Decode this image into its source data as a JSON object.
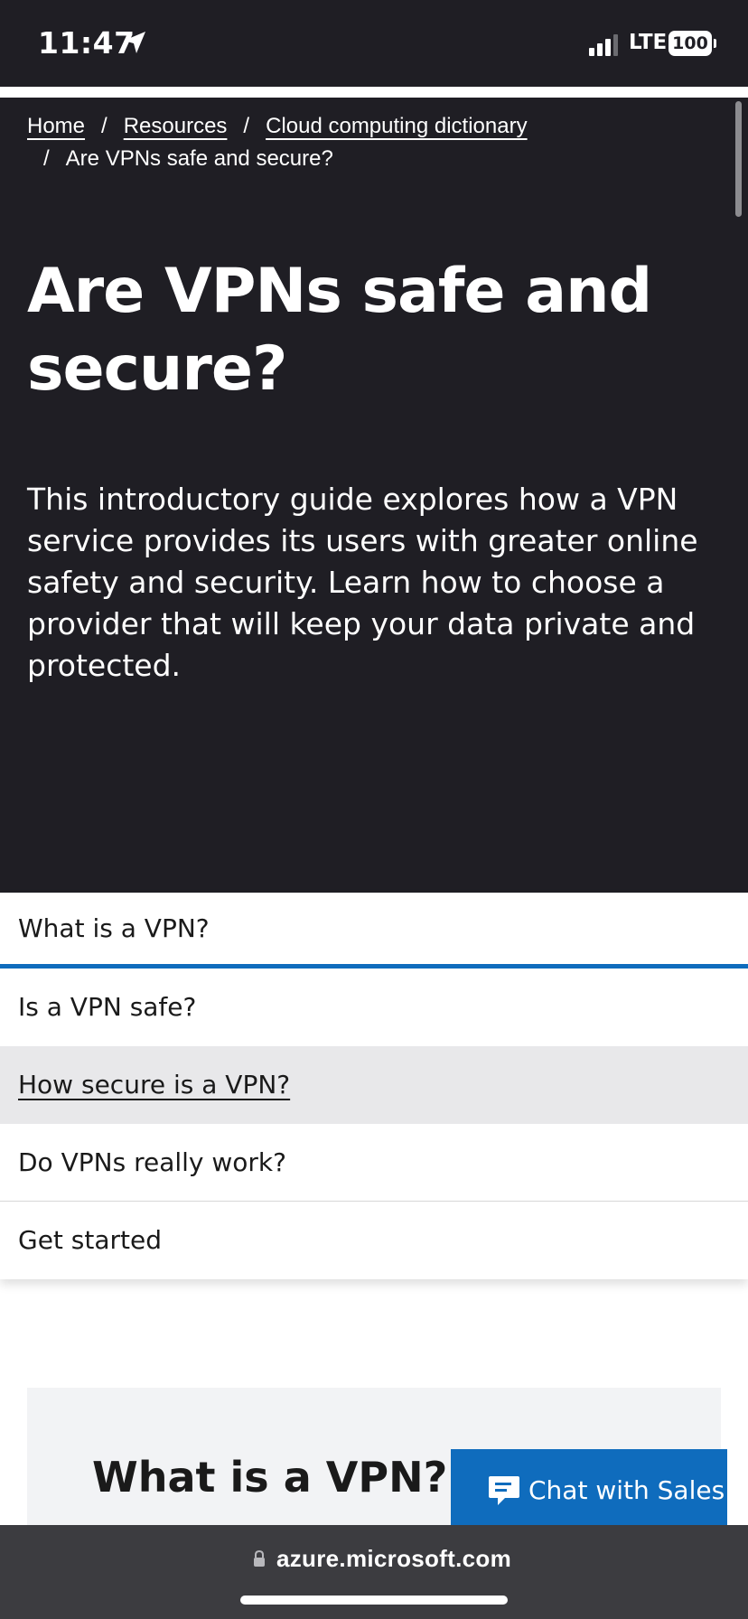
{
  "status_bar": {
    "time": "11:47",
    "network": "LTE",
    "battery": "100"
  },
  "breadcrumb": {
    "items": [
      "Home",
      "Resources",
      "Cloud computing dictionary"
    ],
    "current": "Are VPNs safe and secure?",
    "separator": "/"
  },
  "hero": {
    "title": "Are VPNs safe and secure?",
    "intro": "This introductory guide explores how a VPN service provides its users with greater online safety and security. Learn how to choose a provider that will keep your data private and protected."
  },
  "toc": {
    "items": [
      "What is a VPN?",
      "Is a VPN safe?",
      "How secure is a VPN?",
      "Do VPNs really work?",
      "Get started"
    ]
  },
  "section": {
    "title": "What is a VPN?"
  },
  "chat": {
    "label": "Chat with Sales"
  },
  "browser": {
    "url": "azure.microsoft.com"
  },
  "colors": {
    "hero_bg": "#1f1e24",
    "accent": "#0f6cbd",
    "toc_hover_bg": "#e8e8ea",
    "url_bar_bg": "#3c3c40"
  }
}
